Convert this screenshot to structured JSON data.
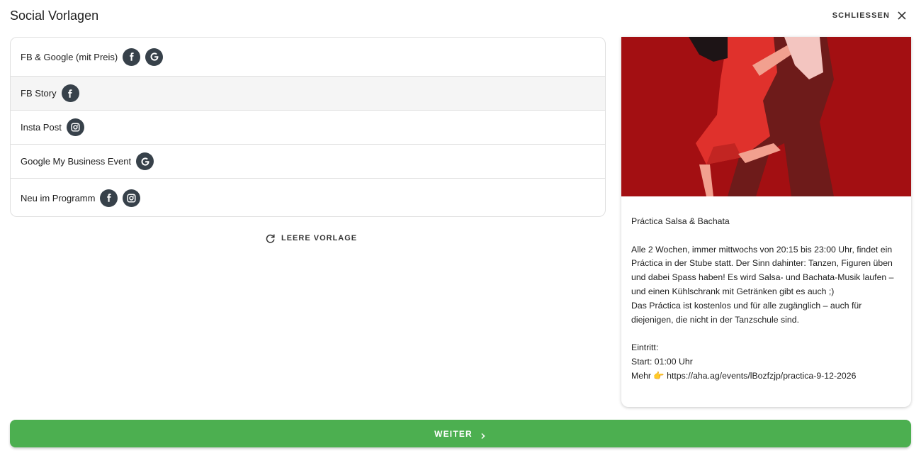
{
  "header": {
    "title": "Social Vorlagen",
    "close_label": "SCHLIESSEN"
  },
  "templates": [
    {
      "label": "FB & Google (mit Preis)",
      "icons": [
        "facebook-icon",
        "google-icon"
      ]
    },
    {
      "label": "FB Story",
      "icons": [
        "facebook-icon"
      ]
    },
    {
      "label": "Insta Post",
      "icons": [
        "instagram-icon"
      ]
    },
    {
      "label": "Google My Business Event",
      "icons": [
        "google-icon"
      ]
    },
    {
      "label": "Neu im Programm",
      "icons": [
        "facebook-icon",
        "instagram-icon"
      ]
    }
  ],
  "selected_template": "FB Story",
  "empty_template_label": "LEERE VORLAGE",
  "preview": {
    "title": "Práctica Salsa & Bachata",
    "paragraph1": "Alle 2 Wochen, immer mittwochs von 20:15 bis 23:00 Uhr, findet ein Práctica in der Stube statt. Der Sinn dahinter: Tanzen, Figuren üben und dabei Spass haben! Es wird Salsa- und Bachata-Musik laufen – und einen Kühlschrank mit Getränken gibt es auch ;)",
    "paragraph2": "Das Práctica ist kostenlos und für alle zugänglich – auch für diejenigen, die nicht in der Tanzschule sind.",
    "entry_label": "Eintritt:",
    "start_line": "Start: 01:00 Uhr",
    "more_line": "Mehr 👉 https://aha.ag/events/lBozfzjp/practica-9-12-2026"
  },
  "next_label": "WEITER",
  "colors": {
    "accent_green": "#4caf50",
    "icon_bg": "#37414a",
    "image_red": "#a30f12"
  }
}
